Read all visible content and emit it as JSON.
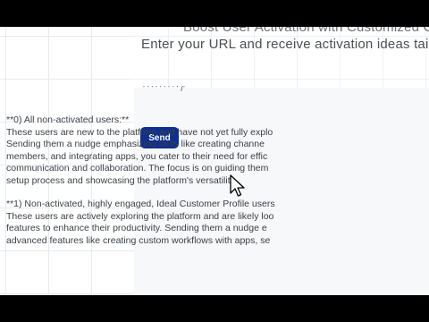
{
  "header": {
    "title": "Boost User Activation with Customized Cor",
    "subtitle": "Enter your URL and receive activation ideas tailored"
  },
  "form": {
    "input_fragment": "' ' ' ' ' ' ' ' ' /'",
    "send_label": "Send"
  },
  "output": {
    "segments": [
      {
        "heading": "**0) All non-activated users:**",
        "lines": [
          "These users are new to the platform and have not yet fully explo",
          "Sending them a nu",
          "dge emphasizing tools like creating channe",
          "members, and inte",
          "grating apps, you cater to their need for effic",
          "communication and collaboration. The focus is on guiding them",
          "setup process and showcasing the platform's versatility."
        ]
      },
      {
        "heading": "**1) Non-activated, highly engaged, Ideal Customer Profile users",
        "lines": [
          "These users are actively exploring the platform and are likely loo",
          "features to enhance their productivity. Sending them a nudge e",
          "advanced features like creating custom workflows with apps, se"
        ]
      }
    ]
  },
  "colors": {
    "send_button_bg": "#0f2f8f",
    "panel_bg": "#f7f8fa"
  }
}
